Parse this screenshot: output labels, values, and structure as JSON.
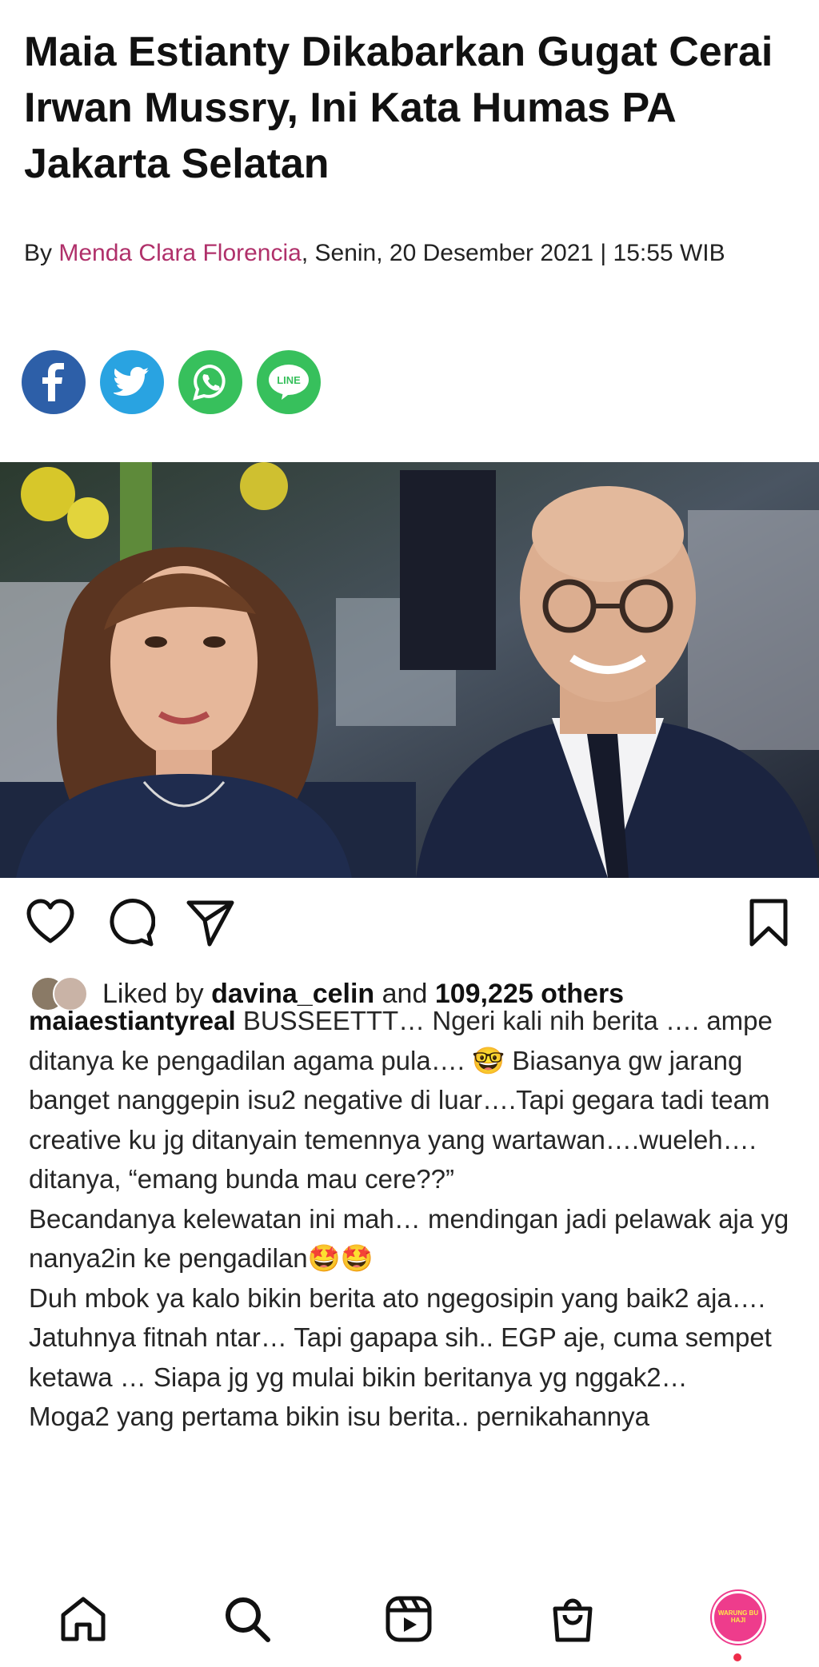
{
  "article": {
    "title": "Maia Estianty Dikabarkan Gugat Cerai Irwan Mussry, Ini Kata Humas PA Jakarta Selatan",
    "byline": {
      "prefix": "By ",
      "author": "Menda Clara Florencia",
      "date": ", Senin, 20 Desember 2021 | 15:55 WIB"
    },
    "share": [
      {
        "network": "facebook",
        "icon": "facebook-icon",
        "color": "#2d5fa8"
      },
      {
        "network": "twitter",
        "icon": "twitter-icon",
        "color": "#29a3e1"
      },
      {
        "network": "whatsapp",
        "icon": "whatsapp-icon",
        "color": "#37c05c"
      },
      {
        "network": "line",
        "icon": "line-icon",
        "label": "LINE",
        "color": "#37c05c"
      }
    ]
  },
  "post": {
    "actions": [
      "like-heart-icon",
      "comment-bubble-icon",
      "share-paper-plane-icon",
      "save-bookmark-icon"
    ],
    "likes": {
      "prefix": "Liked by ",
      "user": "davina_celin",
      "middle": " and ",
      "count_text": "109,225 others"
    },
    "caption": {
      "username": "maiaestiantyreal",
      "text": " BUSSEETTT… Ngeri kali nih berita …. ampe ditanya ke pengadilan agama pula…. 🤓 Biasanya gw jarang banget nanggepin isu2 negative di luar….Tapi gegara tadi team creative ku jg ditanyain temennya yang wartawan….wueleh…. ditanya, “emang bunda mau cere??”\nBecandanya kelewatan ini mah… mendingan jadi pelawak aja yg nanya2in ke pengadilan🤩🤩\nDuh mbok ya kalo bikin berita ato ngegosipin yang baik2 aja….\nJatuhnya fitnah ntar… Tapi gapapa sih.. EGP aje, cuma sempet ketawa … Siapa jg yg mulai bikin beritanya yg nggak2…\nMoga2 yang pertama bikin isu berita.. pernikahannya"
    }
  },
  "bottom_nav": {
    "items": [
      "home-icon",
      "search-icon",
      "reels-icon",
      "shop-bag-icon",
      "profile-avatar"
    ],
    "profile_label": "WARUNG BU HAJI"
  },
  "colors": {
    "author_link": "#b0306a",
    "profile_ring": "#ee3c8c",
    "notification_dot": "#ee2c4a"
  }
}
